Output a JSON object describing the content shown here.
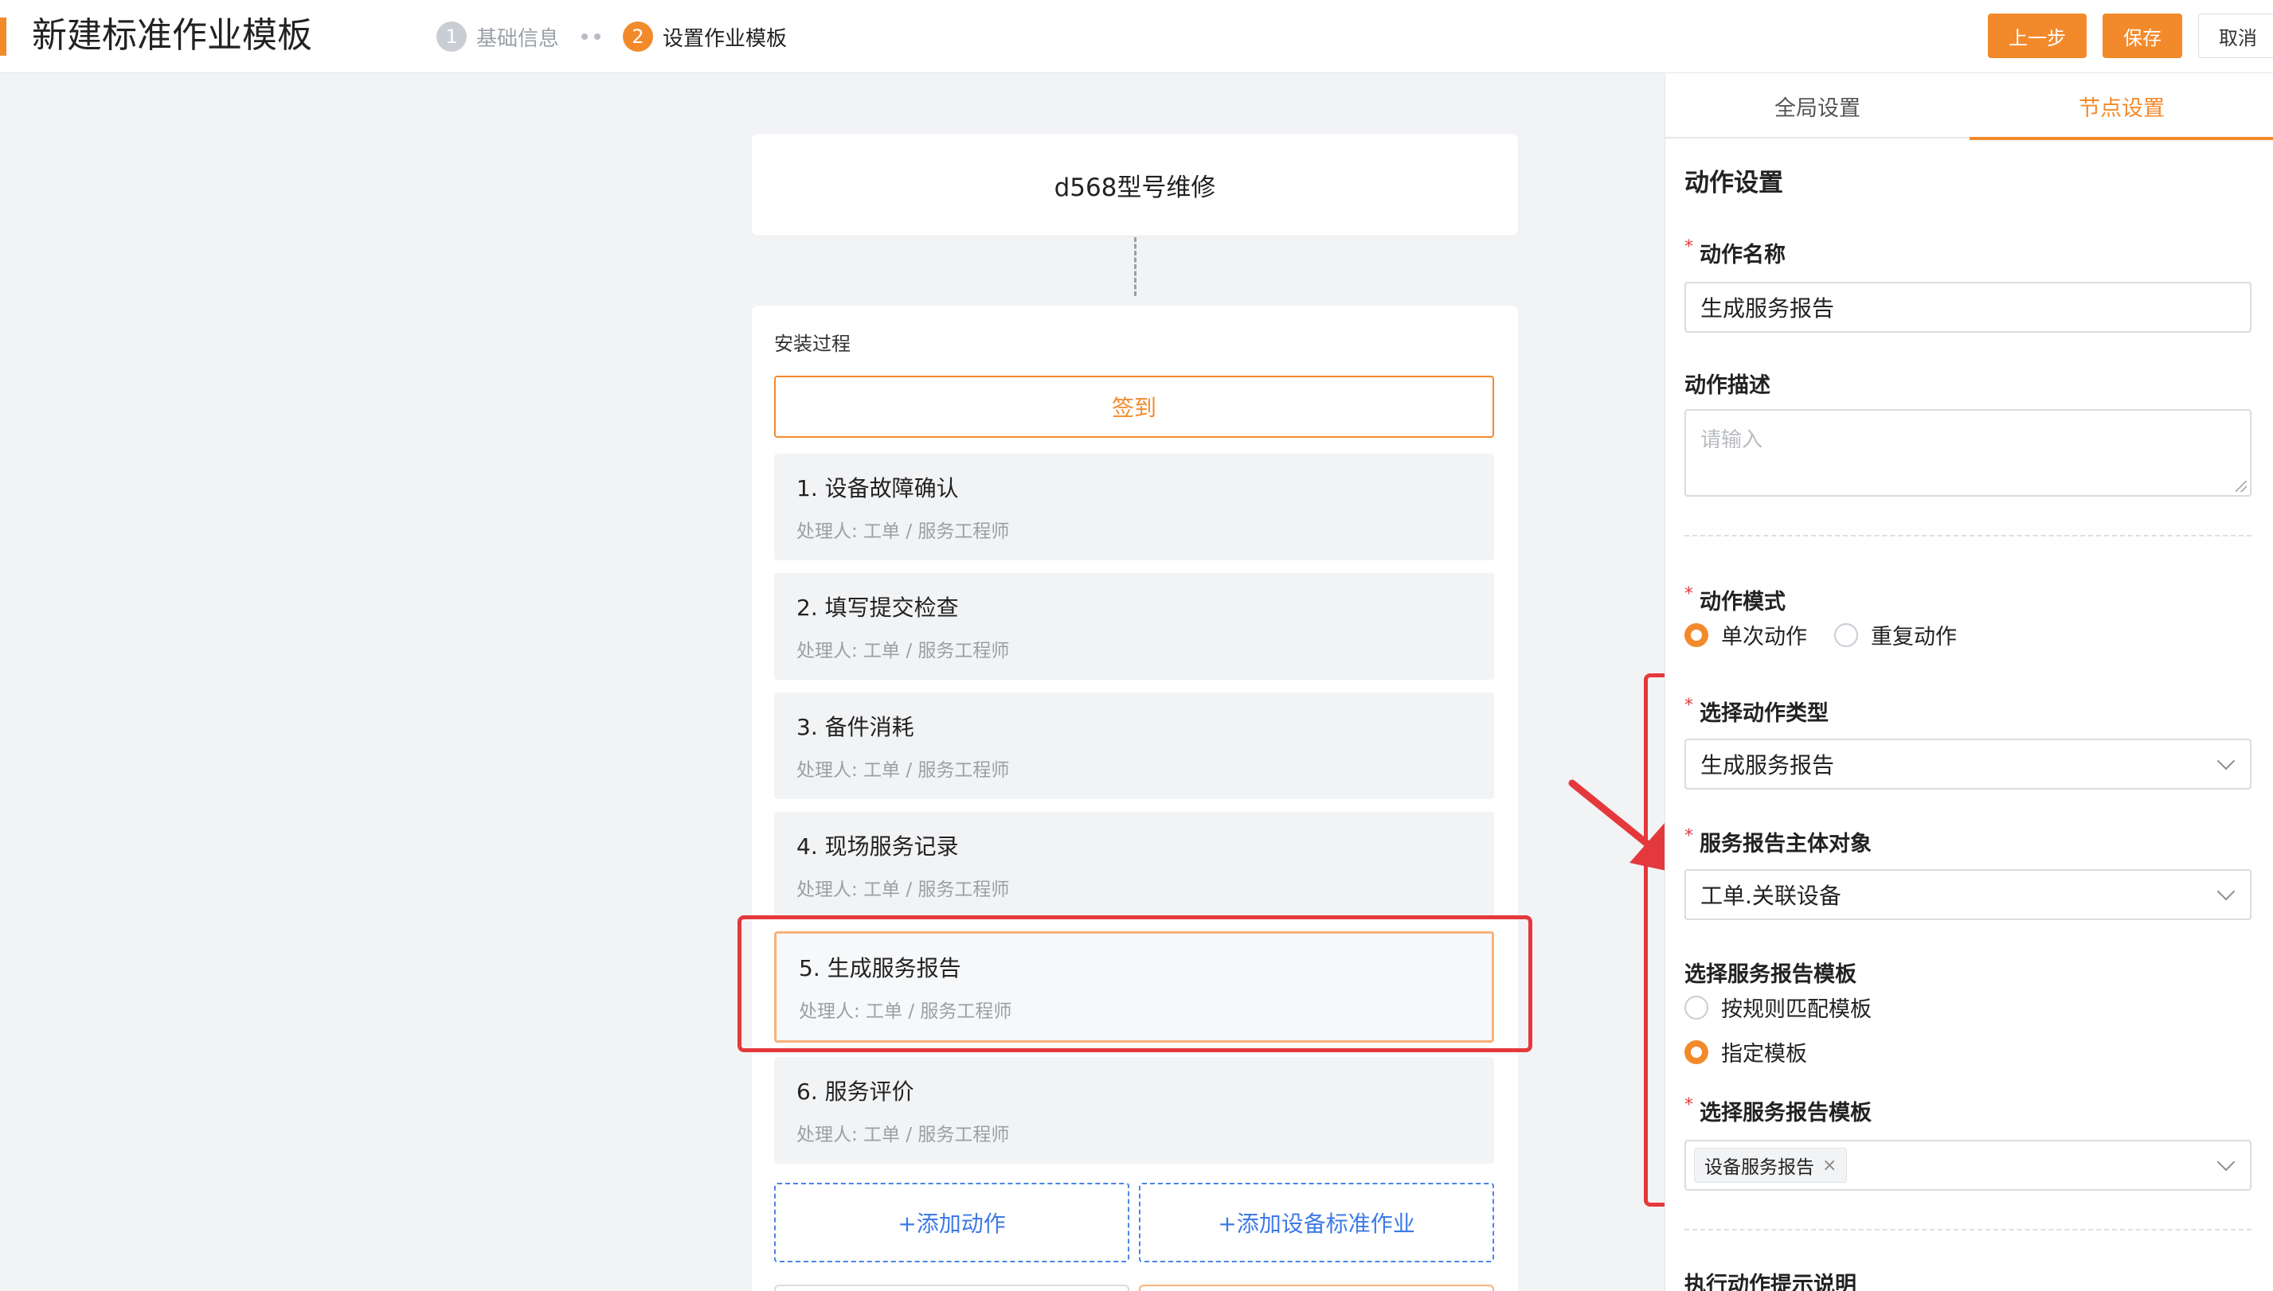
{
  "header": {
    "title": "新建标准作业模板",
    "steps": [
      {
        "num": "1",
        "label": "基础信息"
      },
      {
        "num": "2",
        "label": "设置作业模板"
      }
    ],
    "buttons": {
      "prev": "上一步",
      "save": "保存",
      "cancel": "取消"
    }
  },
  "canvas": {
    "root_title": "d568型号维修",
    "process_title": "安装过程",
    "checkin_label": "签到",
    "actions": [
      {
        "name": "1. 设备故障确认",
        "handler": "处理人:  工单 / 服务工程师"
      },
      {
        "name": "2. 填写提交检查",
        "handler": "处理人:  工单 / 服务工程师"
      },
      {
        "name": "3. 备件消耗",
        "handler": "处理人:  工单 / 服务工程师"
      },
      {
        "name": "4. 现场服务记录",
        "handler": "处理人:  工单 / 服务工程师"
      },
      {
        "name": "5. 生成服务报告",
        "handler": "处理人:  工单 / 服务工程师"
      },
      {
        "name": "6. 服务评价",
        "handler": "处理人:  工单 / 服务工程师"
      }
    ],
    "add_action_label": "+添加动作",
    "add_standard_label": "+添加设备标准作业"
  },
  "panel": {
    "tabs": [
      "全局设置",
      "节点设置"
    ],
    "section_title": "动作设置",
    "action_name_label": "动作名称",
    "action_name_value": "生成服务报告",
    "action_desc_label": "动作描述",
    "action_desc_placeholder": "请输入",
    "action_mode_label": "动作模式",
    "action_mode_options": [
      "单次动作",
      "重复动作"
    ],
    "action_type_label": "选择动作类型",
    "action_type_value": "生成服务报告",
    "subject_label": "服务报告主体对象",
    "subject_value": "工单.关联设备",
    "template_mode_label": "选择服务报告模板",
    "template_mode_options": [
      "按规则匹配模板",
      "指定模板"
    ],
    "template_label": "选择服务报告模板",
    "template_tag": "设备服务报告",
    "hint_label": "执行动作提示说明"
  },
  "colors": {
    "accent": "#f28a2b",
    "highlight": "#e4393c",
    "link": "#3d7ae6"
  }
}
